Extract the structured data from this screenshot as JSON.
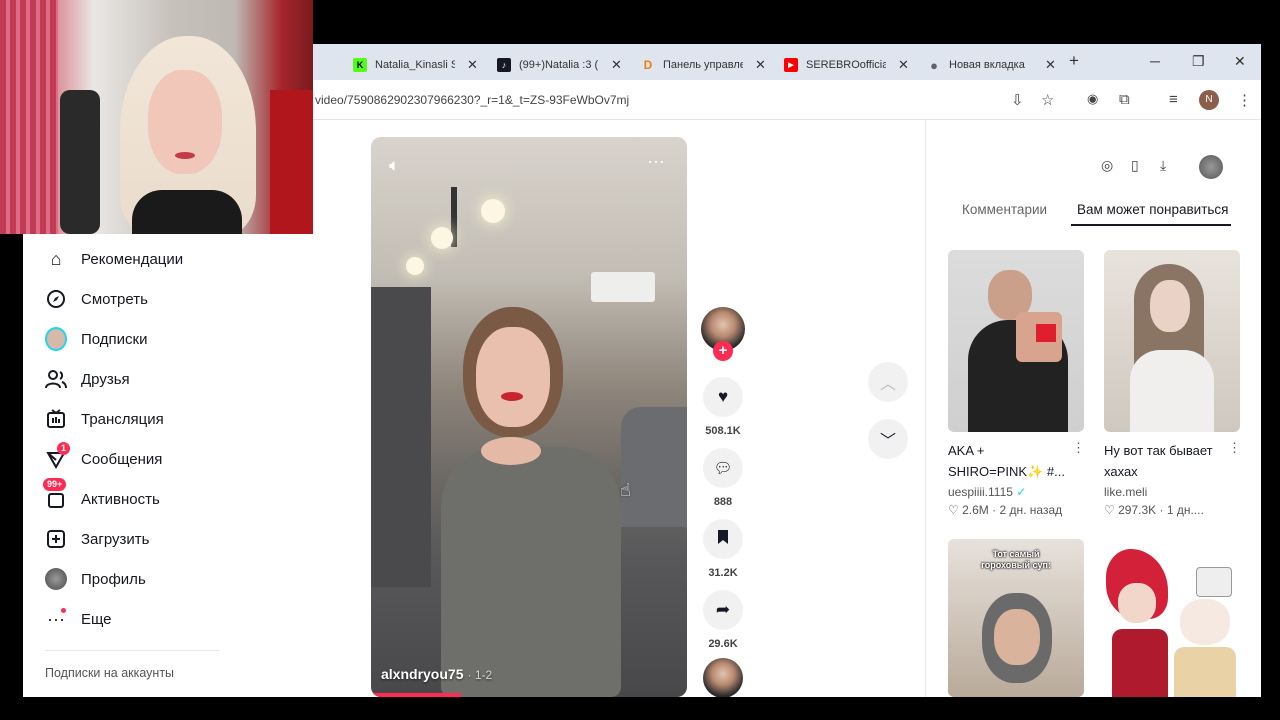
{
  "browser": {
    "tabs": [
      {
        "title": "Natalia_Kinasli S",
        "fav": "K",
        "fav_color": "#53fc18"
      },
      {
        "title": "(99+)Natalia :3 (",
        "fav": "♪",
        "fav_color": "#161823"
      },
      {
        "title": "Панель управле",
        "fav": "D",
        "fav_color": "#f57d07"
      },
      {
        "title": "SEREBROofficial",
        "fav": "▶",
        "fav_color": "#ff0000"
      },
      {
        "title": "Новая вкладка",
        "fav": "●",
        "fav_color": "#5f6368"
      }
    ],
    "new_tab": "+",
    "minimize": "─",
    "restore": "❐",
    "close": "✕",
    "url": "video/7590862902307966230?_r=1&_t=ZS-93FeWbOv7mj",
    "profile_initial": "N"
  },
  "sidebar": {
    "items": [
      {
        "label": "Рекомендации",
        "icon": "home-icon"
      },
      {
        "label": "Смотреть",
        "icon": "compass-icon"
      },
      {
        "label": "Подписки",
        "icon": "following-avatar-icon"
      },
      {
        "label": "Друзья",
        "icon": "friends-icon"
      },
      {
        "label": "Трансляция",
        "icon": "live-icon"
      },
      {
        "label": "Сообщения",
        "icon": "messages-icon",
        "badge": "1"
      },
      {
        "label": "Активность",
        "icon": "activity-icon",
        "badge": "99+"
      },
      {
        "label": "Загрузить",
        "icon": "upload-icon"
      },
      {
        "label": "Профиль",
        "icon": "profile-avatar-icon"
      },
      {
        "label": "Еще",
        "icon": "more-icon"
      }
    ],
    "following_accounts": "Подписки на аккаунты"
  },
  "video": {
    "author": "alxndryou75",
    "part": "· 1-2",
    "likes": "508.1K",
    "comments": "888",
    "saves": "31.2K",
    "shares": "29.6K"
  },
  "right_panel": {
    "tab_comments": "Комментарии",
    "tab_recommended": "Вам может понравиться",
    "cards": [
      {
        "title": "AKA + SHIRO=PINK✨ #...",
        "user": "uespiiii.1115",
        "verified": true,
        "likes": "2.6M",
        "time": "2 дн. назад"
      },
      {
        "title": "Ну вот так бывает хахах",
        "user": "like.meli",
        "verified": false,
        "likes": "297.3K",
        "time": "1 дн...."
      },
      {
        "overlay": "Тот самый гороховый суп:"
      },
      {
        "overlay": ""
      }
    ]
  },
  "colors": {
    "accent": "#fe2c55",
    "text": "#161823"
  }
}
